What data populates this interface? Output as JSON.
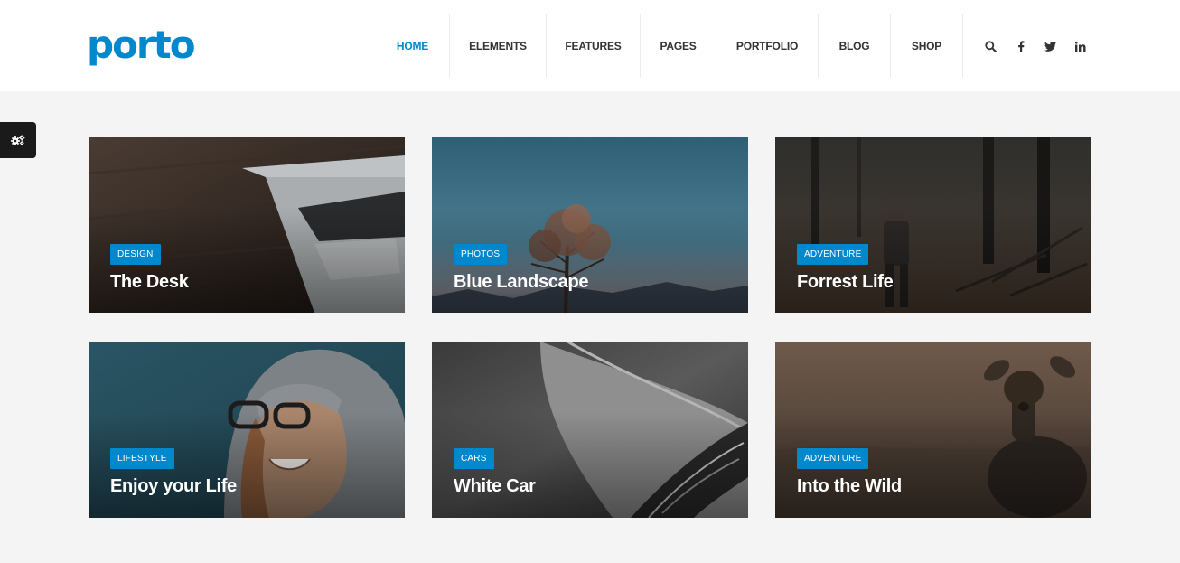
{
  "brand": {
    "logo_text": "porto",
    "accent_color": "#0088cc"
  },
  "nav": {
    "items": [
      {
        "label": "HOME",
        "active": true
      },
      {
        "label": "ELEMENTS",
        "active": false
      },
      {
        "label": "FEATURES",
        "active": false
      },
      {
        "label": "PAGES",
        "active": false
      },
      {
        "label": "PORTFOLIO",
        "active": false
      },
      {
        "label": "BLOG",
        "active": false
      },
      {
        "label": "SHOP",
        "active": false
      }
    ],
    "icons": [
      "search-icon",
      "facebook-icon",
      "twitter-icon",
      "linkedin-icon"
    ]
  },
  "config_button": {
    "icon": "gears-icon"
  },
  "cards": [
    {
      "tag": "DESIGN",
      "title": "The Desk",
      "image": "laptop on wooden desk"
    },
    {
      "tag": "PHOTOS",
      "title": "Blue Landscape",
      "image": "tree against blue sky and mountains"
    },
    {
      "tag": "ADVENTURE",
      "title": "Forrest Life",
      "image": "hiker in dark forest"
    },
    {
      "tag": "LIFESTYLE",
      "title": "Enjoy your Life",
      "image": "smiling woman in hood with glasses"
    },
    {
      "tag": "CARS",
      "title": "White Car",
      "image": "car headlight close-up"
    },
    {
      "tag": "ADVENTURE",
      "title": "Into the Wild",
      "image": "deer in brown field"
    }
  ],
  "colors": {
    "tag_background": "#0088cc",
    "page_background": "#f4f4f4",
    "nav_text": "#333333"
  }
}
